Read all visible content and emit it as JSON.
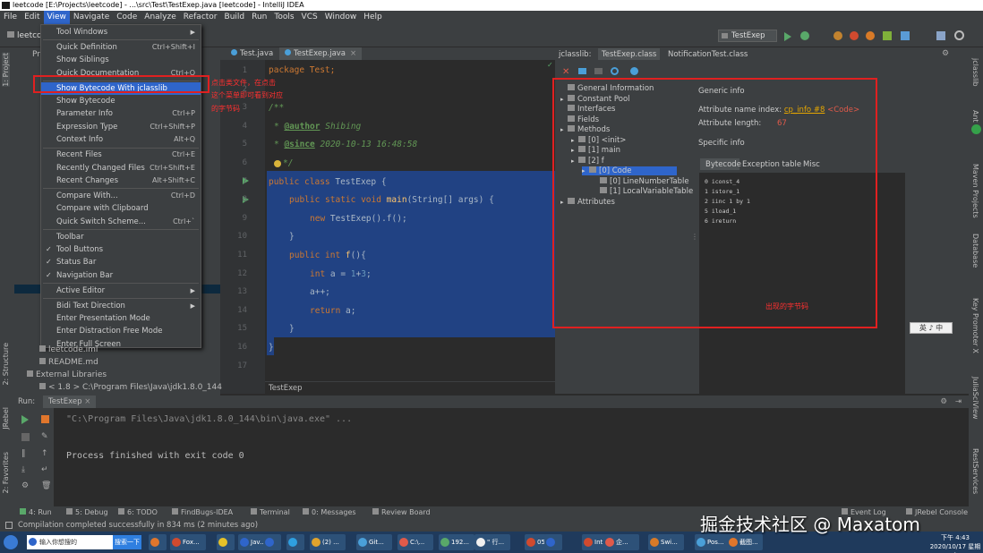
{
  "window": {
    "title": "leetcode [E:\\Projects\\leetcode] - ...\\src\\Test\\TestExep.java [leetcode] - IntelliJ IDEA"
  },
  "menubar": [
    "File",
    "Edit",
    "View",
    "Navigate",
    "Code",
    "Analyze",
    "Refactor",
    "Build",
    "Run",
    "Tools",
    "VCS",
    "Window",
    "Help"
  ],
  "menubar_active": "View",
  "project": {
    "tab": "leetco",
    "pr": "Pr"
  },
  "run_config": "TestExep",
  "view_menu": [
    {
      "label": "Tool Windows",
      "shortcut": "",
      "arrow": true
    },
    {
      "label": "Quick Definition",
      "shortcut": "Ctrl+Shift+I"
    },
    {
      "label": "Show Siblings",
      "shortcut": ""
    },
    {
      "label": "Quick Documentation",
      "shortcut": "Ctrl+Q"
    },
    {
      "label": "Show Bytecode With jclasslib",
      "shortcut": "",
      "selected": true
    },
    {
      "label": "Show Bytecode",
      "shortcut": ""
    },
    {
      "label": "Parameter Info",
      "shortcut": "Ctrl+P"
    },
    {
      "label": "Expression Type",
      "shortcut": "Ctrl+Shift+P"
    },
    {
      "label": "Context Info",
      "shortcut": "Alt+Q"
    },
    {
      "label": "Recent Files",
      "shortcut": "Ctrl+E"
    },
    {
      "label": "Recently Changed Files",
      "shortcut": "Ctrl+Shift+E"
    },
    {
      "label": "Recent Changes",
      "shortcut": "Alt+Shift+C"
    },
    {
      "label": "Compare With...",
      "shortcut": "Ctrl+D"
    },
    {
      "label": "Compare with Clipboard",
      "shortcut": ""
    },
    {
      "label": "Quick Switch Scheme...",
      "shortcut": "Ctrl+`"
    },
    {
      "label": "Toolbar",
      "shortcut": ""
    },
    {
      "label": "Tool Buttons",
      "shortcut": "",
      "check": true
    },
    {
      "label": "Status Bar",
      "shortcut": "",
      "check": true
    },
    {
      "label": "Navigation Bar",
      "shortcut": "",
      "check": true
    },
    {
      "label": "Active Editor",
      "shortcut": "",
      "arrow": true
    },
    {
      "label": "Bidi Text Direction",
      "shortcut": "",
      "arrow": true
    },
    {
      "label": "Enter Presentation Mode",
      "shortcut": ""
    },
    {
      "label": "Enter Distraction Free Mode",
      "shortcut": ""
    },
    {
      "label": "Enter Full Screen",
      "shortcut": ""
    }
  ],
  "annotation_left": [
    "点击类文件，在点击",
    "这个菜单即可看到对应",
    "的字节码"
  ],
  "annotation_right": "出现的字节码",
  "project_tree": [
    {
      "label": "leetcode.iml",
      "indent": 2
    },
    {
      "label": "README.md",
      "indent": 2
    },
    {
      "label": "External Libraries",
      "indent": 1
    },
    {
      "label": "< 1.8 >  C:\\Program Files\\Java\\jdk1.8.0_144",
      "indent": 2
    }
  ],
  "editor_tabs": [
    "Test.java",
    "TestExep.java"
  ],
  "line_numbers": [
    "1",
    "2",
    "3",
    "4",
    "5",
    "6",
    "7",
    "8",
    "9",
    "10",
    "11",
    "12",
    "13",
    "14",
    "15",
    "16",
    "17"
  ],
  "code": {
    "l1": "package Test;",
    "l3": "/**",
    "l4_tag": "@author",
    "l4_val": " Shibing",
    "l5_tag": "@since",
    "l5_val": " 2020-10-13 16:48:58",
    "l6": "*/",
    "l7_kw": "public class ",
    "l7_name": "TestExep {",
    "l8_kw": "public static void ",
    "l8_fn": "main",
    "l8_rest": "(String[] args) {",
    "l9_kw": "new ",
    "l9_rest": "TestExep().f();",
    "l10": "}",
    "l11_kw": "public int ",
    "l11_fn": "f",
    "l11_rest": "(){",
    "l12_kw": "int ",
    "l12_a": "a = ",
    "l12_n1": "1",
    "l12_plus": "+",
    "l12_n2": "3",
    "l12_end": ";",
    "l13": "a++;",
    "l14_kw": "return ",
    "l14_rest": "a;",
    "l15": "}",
    "l16": "}"
  },
  "breadcrumb": "TestExep",
  "jclasslib": {
    "tabs": [
      "jclasslib:",
      "TestExep.class",
      "NotificationTest.class"
    ],
    "tree": [
      {
        "label": "General Information",
        "indent": 0
      },
      {
        "label": "Constant Pool",
        "indent": 0
      },
      {
        "label": "Interfaces",
        "indent": 0
      },
      {
        "label": "Fields",
        "indent": 0
      },
      {
        "label": "Methods",
        "indent": 0
      },
      {
        "label": "[0] <init>",
        "indent": 1
      },
      {
        "label": "[1] main",
        "indent": 1
      },
      {
        "label": "[2] f",
        "indent": 1
      },
      {
        "label": "[0] Code",
        "indent": 2,
        "selected": true
      },
      {
        "label": "[0] LineNumberTable",
        "indent": 3
      },
      {
        "label": "[1] LocalVariableTable",
        "indent": 3
      },
      {
        "label": "Attributes",
        "indent": 0
      }
    ],
    "generic_info": "Generic info",
    "attr_name_label": "Attribute name index:",
    "attr_name_link": "cp_info #8",
    "attr_name_val": "<Code>",
    "attr_len_label": "Attribute length:",
    "attr_len_val": "67",
    "specific_info": "Specific info",
    "sub_tabs": [
      "Bytecode",
      "Exception table",
      "Misc"
    ],
    "bytecode": [
      "0 iconst_4",
      "1 istore_1",
      "2 iinc 1 by 1",
      "5 iload_1",
      "6 ireturn"
    ]
  },
  "ime_widget": "英 ♪ 中",
  "run": {
    "label": "Run:",
    "config": "TestExep",
    "cmd": "\"C:\\Program Files\\Java\\jdk1.8.0_144\\bin\\java.exe\" ...",
    "result": "Process finished with exit code 0"
  },
  "bottom_tabs": [
    "4: Run",
    "5: Debug",
    "6: TODO",
    "FindBugs-IDEA",
    "Terminal",
    "0: Messages",
    "Review Board",
    "Event Log",
    "JRebel Console"
  ],
  "status": "Compilation completed successfully in 834 ms (2 minutes ago)",
  "left_strip": [
    "1: Project",
    "2: Structure",
    "JRebel",
    "2: Favorites"
  ],
  "right_strip": [
    "jclasslib",
    "Ant",
    "Maven Projects",
    "Database",
    "Key Promoter X",
    "JuliaSciView",
    "RestServices"
  ],
  "taskbar": {
    "search": "输入你想搜的",
    "search_btn": "搜索一下",
    "items": [
      "Fox...",
      "Jav...",
      "(2) ...",
      "Git...",
      "C:\\...",
      "192...",
      "\" 行...",
      "05_...",
      "Int...",
      "企...",
      "Swi...",
      "Pos...",
      "截图..."
    ],
    "clock_time": "下午 4:43",
    "clock_date": "2020/10/17 星期六"
  },
  "watermark": "掘金技术社区 @ Maxatom",
  "colors": {
    "accent": "#2f65ca",
    "red": "#e02020",
    "bg": "#2b2b2b",
    "panel": "#3c3f41",
    "selection": "#214283"
  }
}
